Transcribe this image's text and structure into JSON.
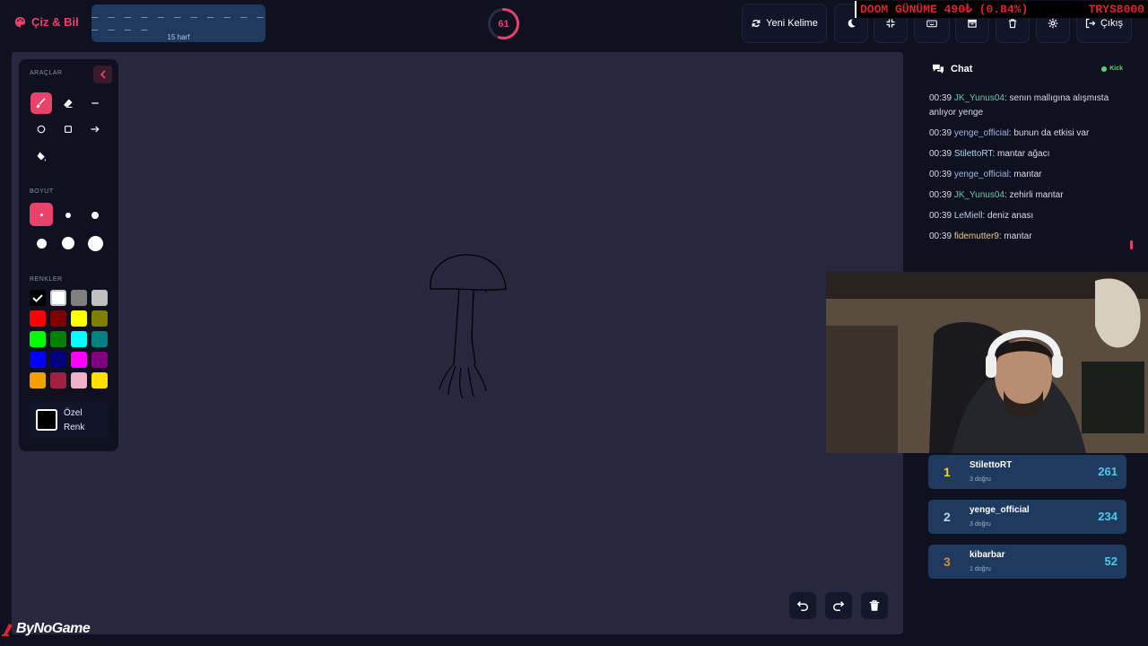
{
  "header": {
    "brand": "Çiz & Bil",
    "word_pattern": "_ _ _ _ _ _ _ _ _ _ _ _ _ _ _",
    "word_length": "15 harf",
    "timer": "61",
    "timer_progress": 0.55,
    "new_word_label": "Yeni Kelime",
    "exit_label": "Çıkış"
  },
  "ticker": {
    "left": "DOOM GÜNÜME  490₺ (0.84%)",
    "right": "TRYS8000"
  },
  "toolbox": {
    "tools_label": "ARAÇLAR",
    "size_label": "BOYUT",
    "colors_label": "RENKLER",
    "custom_color_label": "Özel Renk",
    "colors": [
      "#000000",
      "#ffffff",
      "#808080",
      "#c0c0c0",
      "#ff0000",
      "#800000",
      "#ffff00",
      "#808000",
      "#00ff00",
      "#008000",
      "#00ffff",
      "#008080",
      "#0000ff",
      "#000080",
      "#ff00ff",
      "#800080",
      "#f0a000",
      "#a02040",
      "#f0b0c8",
      "#ffe000"
    ]
  },
  "chat": {
    "title": "Chat",
    "platform": "Kick",
    "messages": [
      {
        "time": "00:39",
        "user": "JK_Yunus04",
        "color": "#6ec6a8",
        "text": ": senın mallıgına alışmısta anlıyor yenge"
      },
      {
        "time": "00:39",
        "user": "yenge_official",
        "color": "#9ab7e0",
        "text": ": bunun da etkisi var"
      },
      {
        "time": "00:39",
        "user": "StilettoRT",
        "color": "#a8d8f0",
        "text": ": mantar ağacı"
      },
      {
        "time": "00:39",
        "user": "yenge_official",
        "color": "#9ab7e0",
        "text": ": mantar"
      },
      {
        "time": "00:39",
        "user": "JK_Yunus04",
        "color": "#6ec6a8",
        "text": ": zehirli mantar"
      },
      {
        "time": "00:39",
        "user": "LeMiell",
        "color": "#b8c4e8",
        "text": ": deniz anası"
      },
      {
        "time": "00:39",
        "user": "fidemutter9",
        "color": "#e8c890",
        "text": ": mantar"
      }
    ]
  },
  "leaderboard": [
    {
      "rank": "1",
      "name": "StilettoRT",
      "correct": "3 doğru",
      "score": "261",
      "rank_color": "#f5d020"
    },
    {
      "rank": "2",
      "name": "yenge_official",
      "correct": "3 doğru",
      "score": "234",
      "rank_color": "#c8d0e0"
    },
    {
      "rank": "3",
      "name": "kibarbar",
      "correct": "1 doğru",
      "score": "52",
      "rank_color": "#e08a30"
    }
  ],
  "watermark": "ByNoGame",
  "colors": {
    "accent": "#e8436a",
    "panel": "#1f3a5f",
    "canvas": "#272840"
  }
}
